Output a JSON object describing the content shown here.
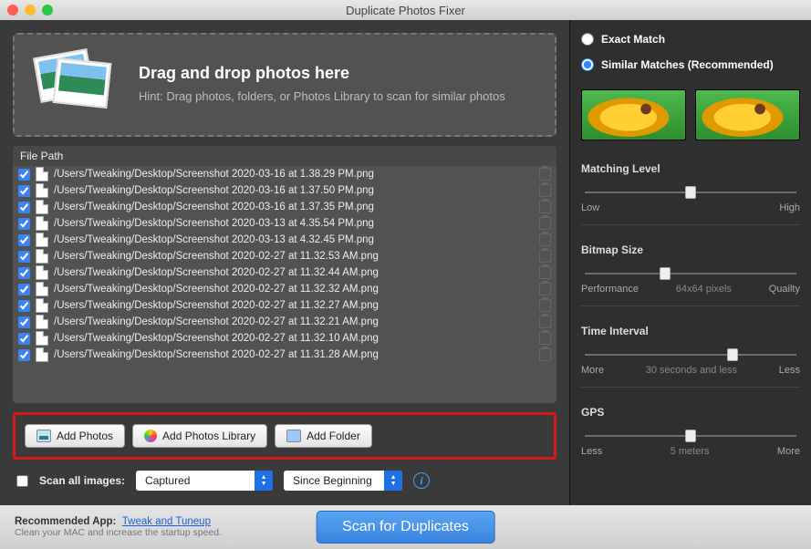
{
  "title": "Duplicate Photos Fixer",
  "dropzone": {
    "heading": "Drag and drop photos here",
    "hint": "Hint: Drag photos, folders, or Photos Library to scan for similar photos"
  },
  "filelist": {
    "header": "File Path",
    "rows": [
      "/Users/Tweaking/Desktop/Screenshot 2020-03-16 at 1.38.29 PM.png",
      "/Users/Tweaking/Desktop/Screenshot 2020-03-16 at 1.37.50 PM.png",
      "/Users/Tweaking/Desktop/Screenshot 2020-03-16 at 1.37.35 PM.png",
      "/Users/Tweaking/Desktop/Screenshot 2020-03-13 at 4.35.54 PM.png",
      "/Users/Tweaking/Desktop/Screenshot 2020-03-13 at 4.32.45 PM.png",
      "/Users/Tweaking/Desktop/Screenshot 2020-02-27 at 11.32.53 AM.png",
      "/Users/Tweaking/Desktop/Screenshot 2020-02-27 at 11.32.44 AM.png",
      "/Users/Tweaking/Desktop/Screenshot 2020-02-27 at 11.32.32 AM.png",
      "/Users/Tweaking/Desktop/Screenshot 2020-02-27 at 11.32.27 AM.png",
      "/Users/Tweaking/Desktop/Screenshot 2020-02-27 at 11.32.21 AM.png",
      "/Users/Tweaking/Desktop/Screenshot 2020-02-27 at 11.32.10 AM.png",
      "/Users/Tweaking/Desktop/Screenshot 2020-02-27 at 11.31.28 AM.png"
    ]
  },
  "buttons": {
    "add_photos": "Add Photos",
    "add_library": "Add Photos Library",
    "add_folder": "Add Folder"
  },
  "scan_all": {
    "label": "Scan all images:",
    "select1": "Captured",
    "select2": "Since Beginning"
  },
  "match_mode": {
    "exact": "Exact Match",
    "similar": "Similar Matches (Recommended)"
  },
  "sliders": {
    "matching": {
      "label": "Matching Level",
      "left": "Low",
      "right": "High",
      "pos": 50
    },
    "bitmap": {
      "label": "Bitmap Size",
      "left": "Performance",
      "mid": "64x64 pixels",
      "right": "Quailty",
      "pos": 38
    },
    "time": {
      "label": "Time Interval",
      "left": "More",
      "mid": "30 seconds and less",
      "right": "Less",
      "pos": 70
    },
    "gps": {
      "label": "GPS",
      "left": "Less",
      "mid": "5 meters",
      "right": "More",
      "pos": 50
    }
  },
  "footer": {
    "rec_label": "Recommended App:",
    "rec_link": "Tweak and Tuneup",
    "rec_sub": "Clean your MAC and increase the startup speed.",
    "scan": "Scan for Duplicates"
  }
}
